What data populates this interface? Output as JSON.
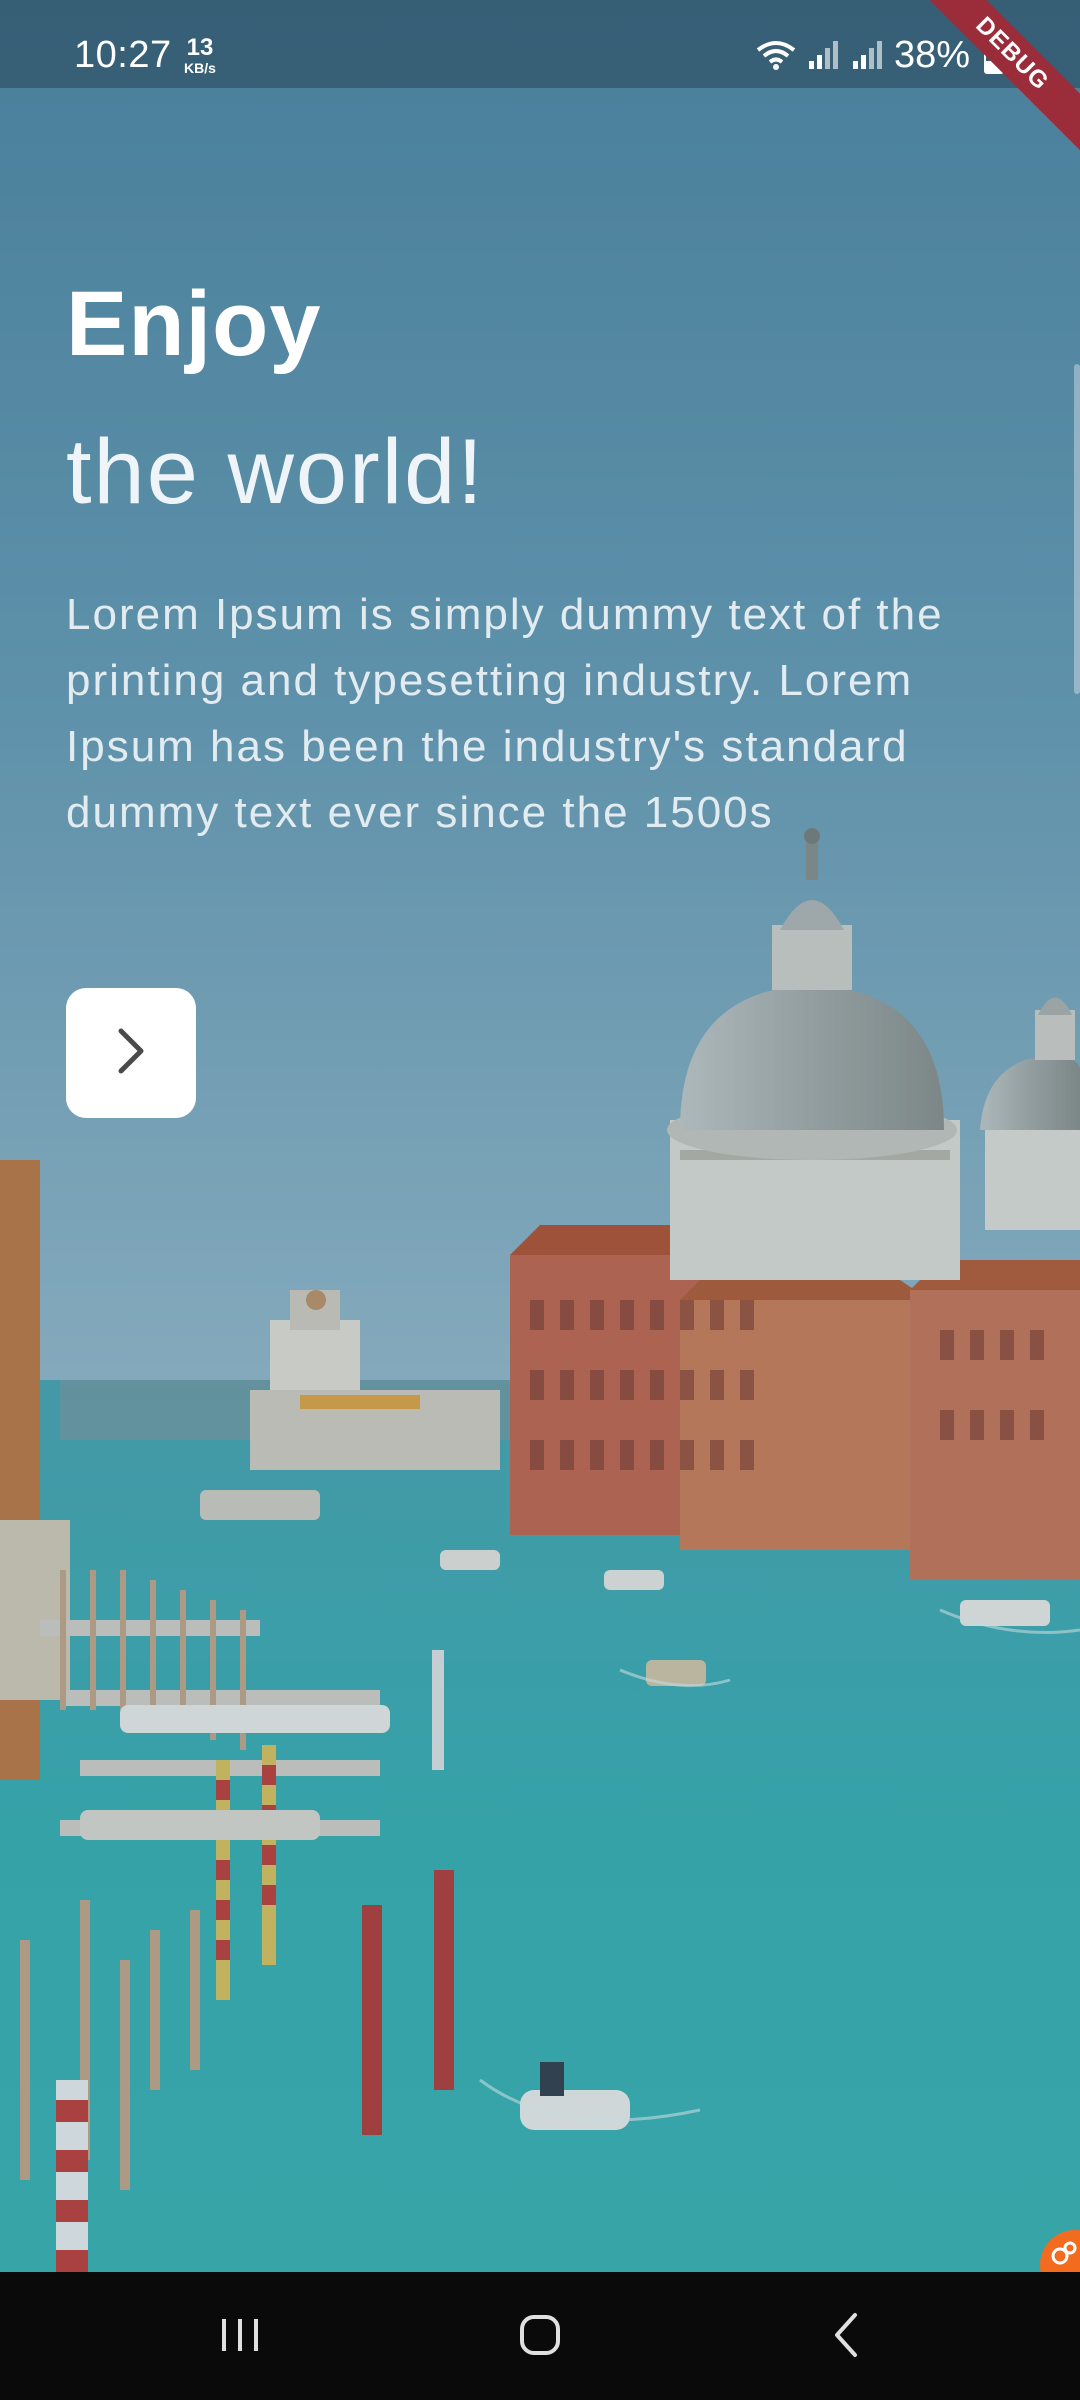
{
  "status_bar": {
    "time": "10:27",
    "net_speed_value": "13",
    "net_speed_unit": "KB/s",
    "battery_percent": "38%",
    "debug_label": "DEBUG"
  },
  "hero": {
    "headline_line1": "Enjoy",
    "headline_line2": "the world!",
    "description": "Lorem Ipsum is simply dummy text of the printing and typesetting industry. Lorem Ipsum has been the industry's standard dummy text ever since the 1500s"
  },
  "icons": {
    "next": "chevron-right-icon",
    "wifi": "wifi-icon",
    "signal": "signal-icon",
    "battery": "battery-icon",
    "recents": "recents-icon",
    "home": "home-icon",
    "back": "back-icon"
  },
  "colors": {
    "sky_top": "#5a8fa8",
    "water": "#3fb3b4",
    "debug_ribbon": "#9b2d3a",
    "button_bg": "#ffffff"
  }
}
